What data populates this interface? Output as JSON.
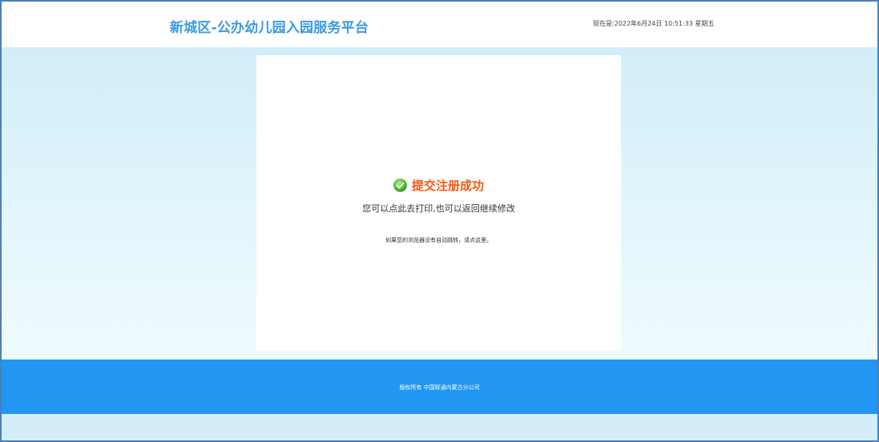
{
  "header": {
    "title": "新城区-公办幼儿园入园服务平台",
    "datetime": "现在是:2022年6月24日 10:51:33 星期五"
  },
  "result": {
    "icon": "check-circle-icon",
    "title": "提交注册成功",
    "subtitle": "您可以点此去打印,也可以返回继续修改",
    "redirect_note": "如果您的浏览器没有自动跳转，请点这里。"
  },
  "footer": {
    "copyright": "版权所有 中国联通内蒙古分公司"
  },
  "colors": {
    "title_blue": "#3b9ae1",
    "success_orange": "#f15a12",
    "footer_blue": "#2196f3",
    "page_bg": "#d3eef9",
    "frame_border": "#4a7fb9"
  }
}
